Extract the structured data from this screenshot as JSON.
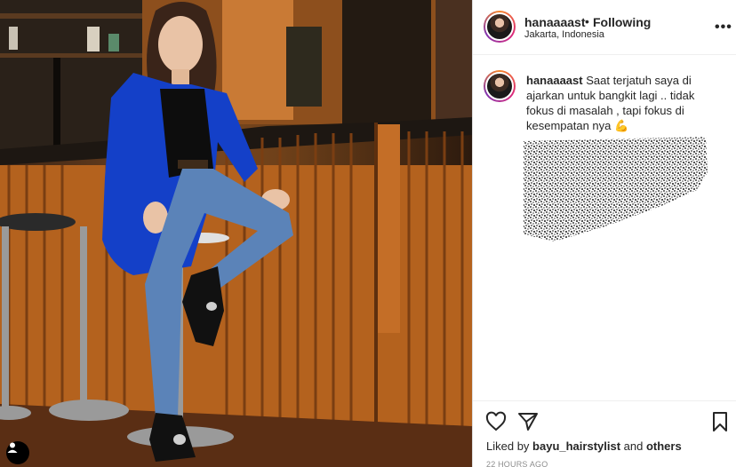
{
  "post": {
    "username": "hanaaaast",
    "follow_separator": "•",
    "follow_status": "Following",
    "location": "Jakarta, Indonesia",
    "more_icon": "more-options-icon",
    "caption_username": "hanaaaast",
    "caption_text": "Saat terjatuh saya di ajarkan untuk bangkit lagi .. tidak fokus di masalah , tapi fokus di kesempatan nya 💪",
    "liked_prefix": "Liked by ",
    "liked_user": "bayu_hairstylist",
    "liked_mid": " and ",
    "liked_others": "others",
    "timestamp": "22 HOURS AGO"
  },
  "icons": {
    "like": "heart-icon",
    "share": "paper-plane-icon",
    "save": "bookmark-icon",
    "tags": "user-tag-icon"
  },
  "colors": {
    "blazer": "#1440c8",
    "jeans": "#5b83b8",
    "wood": "#b4621e",
    "text": "#262626",
    "muted": "#8e8e8e"
  }
}
